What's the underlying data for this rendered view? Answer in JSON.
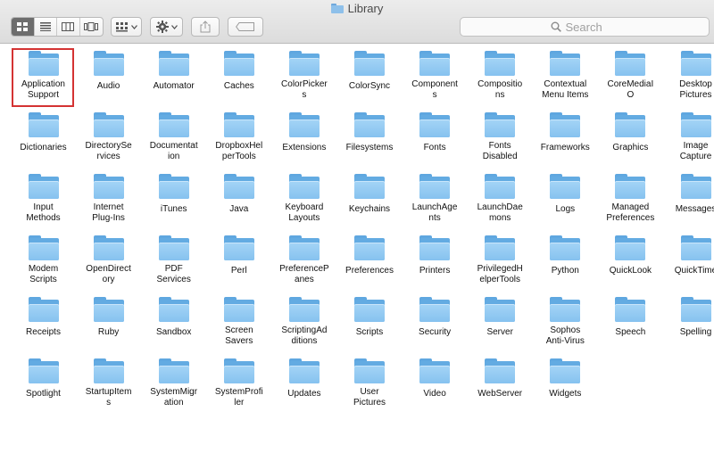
{
  "window": {
    "title": "Library"
  },
  "toolbar": {
    "view_buttons": [
      {
        "name": "icon-view",
        "active": true
      },
      {
        "name": "list-view",
        "active": false
      },
      {
        "name": "column-view",
        "active": false
      },
      {
        "name": "cover-flow-view",
        "active": false
      }
    ],
    "search_placeholder": "Search"
  },
  "colors": {
    "selection": "#d43333",
    "folder": "#86c2ef"
  },
  "items": [
    [
      "Application\nSupport",
      "Audio",
      "Automator",
      "Caches",
      "ColorPicker\ns",
      "ColorSync",
      "Component\ns",
      "Compositio\nns",
      "Contextual\nMenu Items",
      "CoreMediaI\nO",
      "Desktop\nPictures"
    ],
    [
      "Dictionaries",
      "DirectorySe\nrvices",
      "Documentat\nion",
      "DropboxHel\nperTools",
      "Extensions",
      "Filesystems",
      "Fonts",
      "Fonts\nDisabled",
      "Frameworks",
      "Graphics",
      "Image\nCapture"
    ],
    [
      "Input\nMethods",
      "Internet\nPlug-Ins",
      "iTunes",
      "Java",
      "Keyboard\nLayouts",
      "Keychains",
      "LaunchAge\nnts",
      "LaunchDae\nmons",
      "Logs",
      "Managed\nPreferences",
      "Messages"
    ],
    [
      "Modem\nScripts",
      "OpenDirect\nory",
      "PDF\nServices",
      "Perl",
      "PreferenceP\nanes",
      "Preferences",
      "Printers",
      "PrivilegedH\nelperTools",
      "Python",
      "QuickLook",
      "QuickTime"
    ],
    [
      "Receipts",
      "Ruby",
      "Sandbox",
      "Screen\nSavers",
      "ScriptingAd\nditions",
      "Scripts",
      "Security",
      "Server",
      "Sophos\nAnti-Virus",
      "Speech",
      "Spelling"
    ],
    [
      "Spotlight",
      "StartupItem\ns",
      "SystemMigr\nation",
      "SystemProfi\nler",
      "Updates",
      "User\nPictures",
      "Video",
      "WebServer",
      "Widgets"
    ]
  ],
  "selected_item": "Application Support"
}
